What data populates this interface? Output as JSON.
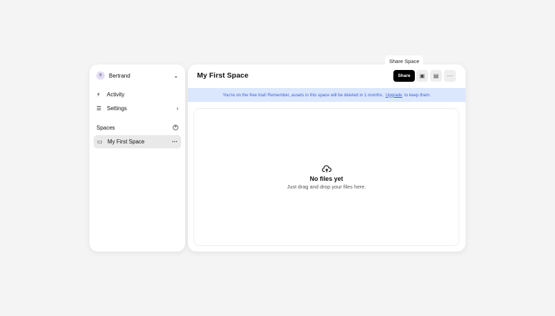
{
  "sidebar": {
    "user": "Bertrand",
    "user_initial": "B",
    "items": [
      {
        "label": "Activity"
      },
      {
        "label": "Settings"
      }
    ],
    "spaces_heading": "Spaces",
    "spaces": [
      {
        "label": "My First Space"
      }
    ]
  },
  "main": {
    "title": "My First Space",
    "share_label": "Share",
    "tooltip": "Share Space",
    "banner_text": "You're on the free trial! Remember, assets in this space will be deleted in 1 months.",
    "banner_link": "Upgrade",
    "banner_suffix": "to keep them.",
    "empty_title": "No files yet",
    "empty_subtitle": "Just drag and drop your files here."
  }
}
